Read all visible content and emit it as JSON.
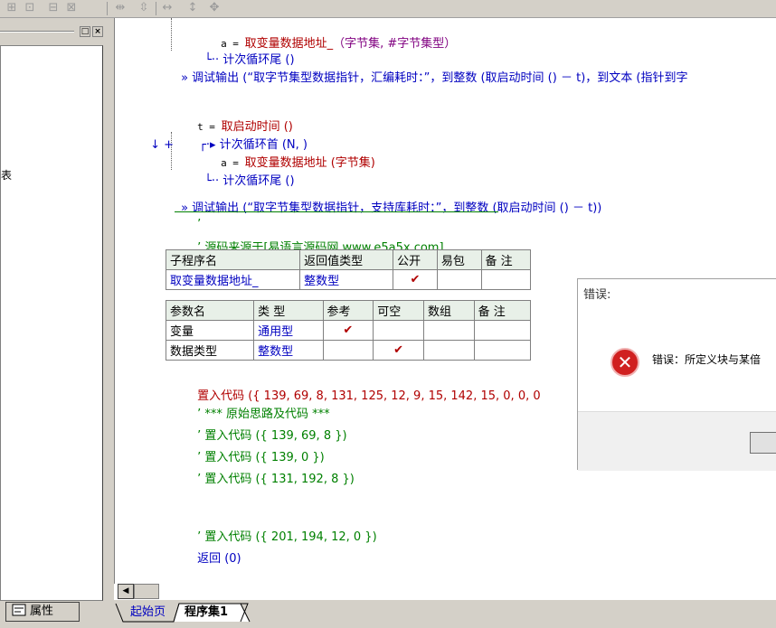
{
  "left_panel": {
    "stub_char": "表",
    "minimize_label": "□",
    "close_label": "×",
    "props_tab_label": "属性"
  },
  "code": {
    "l1_a": "a = ",
    "l1_fn": "取变量数据地址_",
    "l1_args": "（字节集, #字节集型）",
    "l2": "计次循环尾 ()",
    "l3": "调试输出 (“取字节集型数据指针，汇编耗时：”，到整数 (取启动时间 () － t)，到文本 (指针到字",
    "l4_t": "t = ",
    "l4_fn": "取启动时间 ()",
    "l5": "计次循环首 (N, )",
    "l6_a": "a = ",
    "l6_fn": "取变量数据地址 (字节集)",
    "l7": "计次循环尾 ()",
    "l8": "调试输出 (“取字节集型数据指针，支持库耗时：”，到整数 (取启动时间 () － t))",
    "l9": "’",
    "l10": "’ 源码来源于[易语言源码网 www.e5a5x.com]",
    "l11": "置入代码 ({ 139, 69, 8, 131, 125, 12, 9, 15, 142, 15, 0, 0, 0",
    "l12": "’ *** 原始思路及代码 ***",
    "l13": "’ 置入代码 ({ 139, 69, 8 })",
    "l14": "’ 置入代码 ({ 139, 0 })",
    "l15": "’ 置入代码 ({ 131, 192, 8 })",
    "l16": "’ 置入代码 ({ 201, 194, 12, 0 })",
    "l17": "返回 (0)"
  },
  "gutter": {
    "arrow": "↓",
    "plus": "+",
    "run_marker": "»"
  },
  "sub_table": {
    "h1": "子程序名",
    "h2": "返回值类型",
    "h3": "公开",
    "h4": "易包",
    "h5": "备 注",
    "name": "取变量数据地址_",
    "ret": "整数型",
    "public": "✔"
  },
  "param_table": {
    "h1": "参数名",
    "h2": "类 型",
    "h3": "参考",
    "h4": "可空",
    "h5": "数组",
    "h6": "备 注",
    "rows": [
      {
        "name": "变量",
        "type": "通用型",
        "ref": "✔",
        "opt": ""
      },
      {
        "name": "数据类型",
        "type": "整数型",
        "ref": "",
        "opt": "✔"
      }
    ]
  },
  "tabs": {
    "start": "起始页",
    "proc": "程序集1"
  },
  "dialog": {
    "title": "错误:",
    "icon": "✕",
    "message": "错误：所定义块与某偣"
  },
  "scroll": {
    "left_arrow": "◀"
  }
}
